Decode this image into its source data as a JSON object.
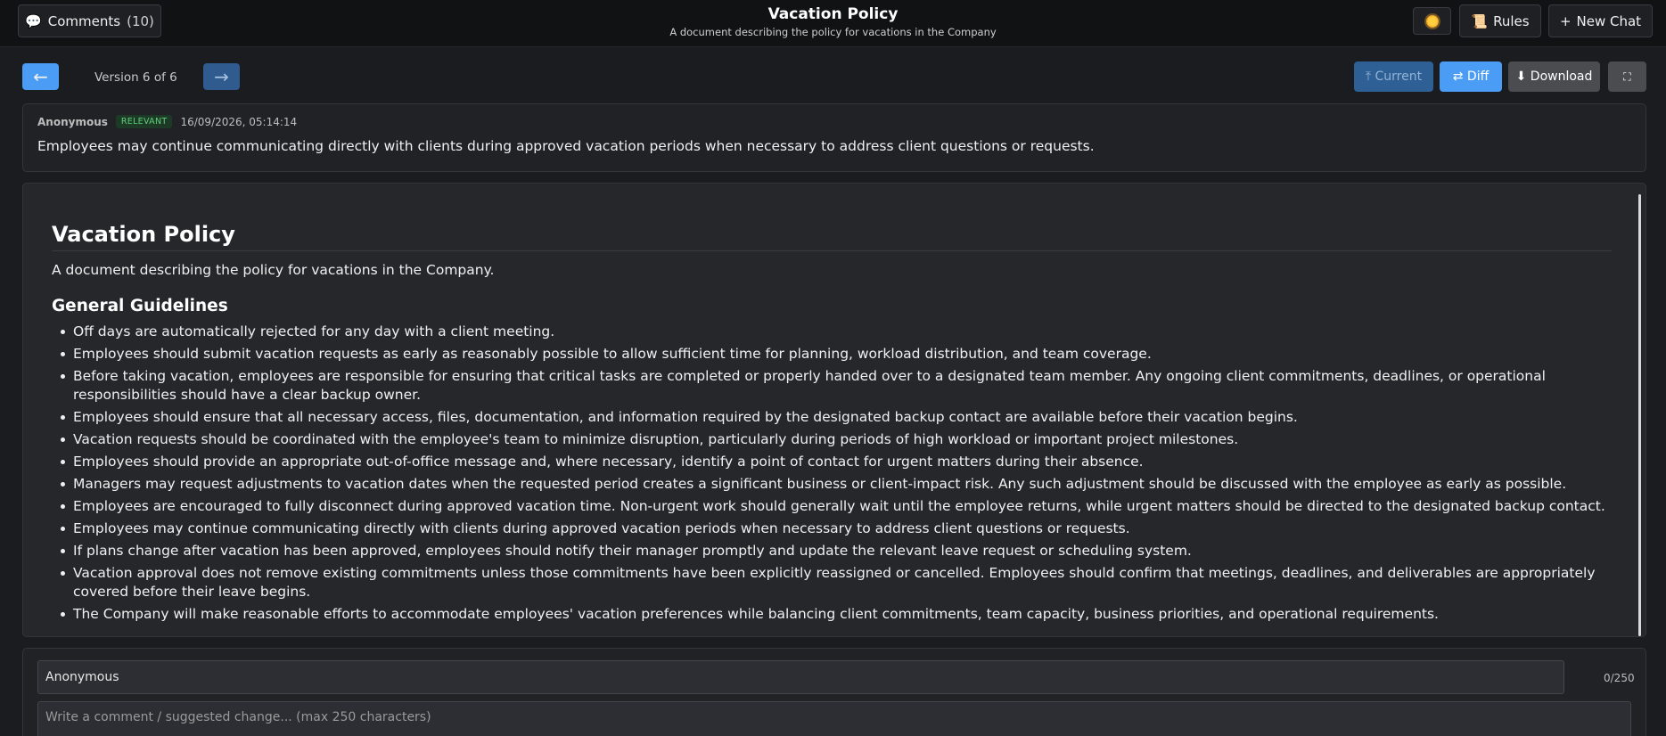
{
  "header": {
    "comments_label": "Comments",
    "comments_count": "(10)",
    "comments_icon": "speech-bubble-icon",
    "title": "Vacation Policy",
    "subtitle": "A document describing the policy for vacations in the Company",
    "theme_icon": "sun-icon",
    "rules_label": "Rules",
    "rules_icon": "scroll-icon",
    "new_chat_label": "New Chat",
    "new_chat_icon": "plus-icon"
  },
  "version_nav": {
    "prev_glyph": "←",
    "next_glyph": "→",
    "label": "Version 6 of 6"
  },
  "toolbar": {
    "current_label": "⤒ Current",
    "diff_label": "⇄ Diff",
    "download_label": "⬇ Download",
    "fullscreen_glyph": "⛶"
  },
  "comment": {
    "author": "Anonymous",
    "badge": "RELEVANT",
    "timestamp": "16/09/2026, 05:14:14",
    "text": "Employees may continue communicating directly with clients during approved vacation periods when necessary to address client questions or requests."
  },
  "document": {
    "title": "Vacation Policy",
    "intro": "A document describing the policy for vacations in the Company.",
    "section_title": "General Guidelines",
    "items": [
      "Off days are automatically rejected for any day with a client meeting.",
      "Employees should submit vacation requests as early as reasonably possible to allow sufficient time for planning, workload distribution, and team coverage.",
      "Before taking vacation, employees are responsible for ensuring that critical tasks are completed or properly handed over to a designated team member. Any ongoing client commitments, deadlines, or operational responsibilities should have a clear backup owner.",
      "Employees should ensure that all necessary access, files, documentation, and information required by the designated backup contact are available before their vacation begins.",
      "Vacation requests should be coordinated with the employee's team to minimize disruption, particularly during periods of high workload or important project milestones.",
      "Employees should provide an appropriate out-of-office message and, where necessary, identify a point of contact for urgent matters during their absence.",
      "Managers may request adjustments to vacation dates when the requested period creates a significant business or client-impact risk. Any such adjustment should be discussed with the employee as early as possible.",
      "Employees are encouraged to fully disconnect during approved vacation time. Non-urgent work should generally wait until the employee returns, while urgent matters should be directed to the designated backup contact.",
      "Employees may continue communicating directly with clients during approved vacation periods when necessary to address client questions or requests.",
      "If plans change after vacation has been approved, employees should notify their manager promptly and update the relevant leave request or scheduling system.",
      "Vacation approval does not remove existing commitments unless those commitments have been explicitly reassigned or cancelled. Employees should confirm that meetings, deadlines, and deliverables are appropriately covered before their leave begins.",
      "The Company will make reasonable efforts to accommodate employees' vacation preferences while balancing client commitments, team capacity, business priorities, and operational requirements."
    ]
  },
  "compose": {
    "name_value": "Anonymous",
    "char_count": "0/250",
    "comment_placeholder": "Write a comment / suggested change... (max 250 characters)"
  },
  "colors": {
    "accent": "#4a9cf5",
    "background": "#1b1c20",
    "relevant_badge": "#5fcf7a"
  }
}
